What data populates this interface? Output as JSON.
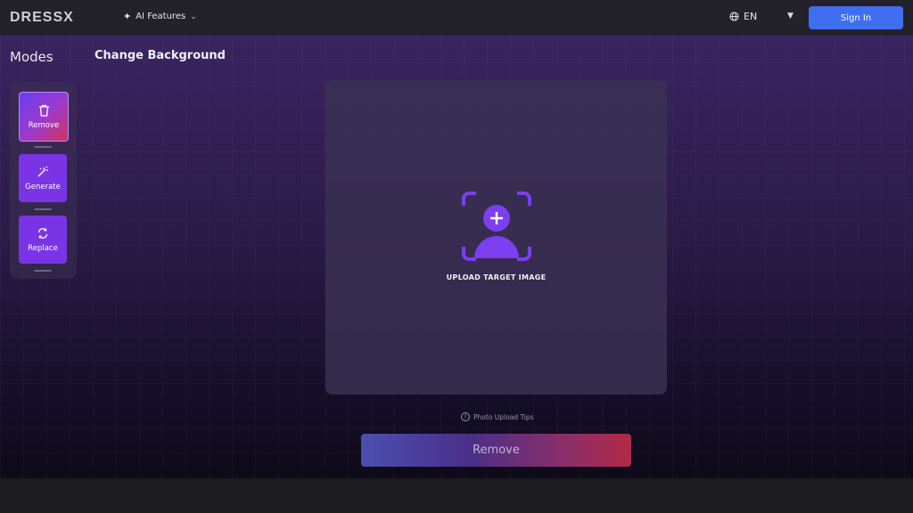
{
  "header": {
    "logo": "DRESSX",
    "ai_features_label": "AI Features",
    "language": "EN",
    "sign_in_label": "Sign In"
  },
  "sidebar": {
    "title": "Modes",
    "modes": [
      {
        "label": "Remove",
        "icon": "trash-icon",
        "active": true
      },
      {
        "label": "Generate",
        "icon": "magic-wand-icon",
        "active": false
      },
      {
        "label": "Replace",
        "icon": "refresh-icon",
        "active": false
      }
    ]
  },
  "main": {
    "title": "Change Background",
    "upload_label": "UPLOAD TARGET IMAGE",
    "tips_label": "Photo Upload Tips",
    "action_button_label": "Remove"
  },
  "colors": {
    "accent": "#7a34e6",
    "sign_in": "#3f6ff0",
    "header_bg": "#232129"
  }
}
